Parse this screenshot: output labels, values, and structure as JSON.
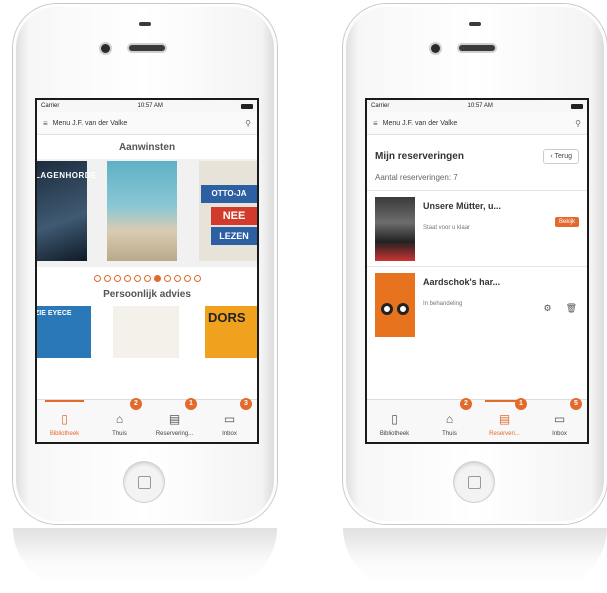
{
  "left_phone": {
    "status": {
      "carrier": "Carrier",
      "time": "10:57 AM"
    },
    "nav": {
      "title": "Menu J.F. van der Valke"
    },
    "aanwinsten_title": "Aanwinsten",
    "carousel_texts": {
      "book1": "LAGENHORDE",
      "book3_line1": "OTTO-JA",
      "book3_line2": "NEE",
      "book3_line3": "LEZEN"
    },
    "carousel": {
      "dot_count": 11,
      "active_index": 6
    },
    "advies_title": "Persoonlijk advies",
    "advies_texts": {
      "book1": "ZIE EYECE",
      "book3": "DORS"
    },
    "tabs": [
      {
        "label": "Bibliotheek",
        "badge": ""
      },
      {
        "label": "Thuis",
        "badge": "2"
      },
      {
        "label": "Reservering...",
        "badge": "1"
      },
      {
        "label": "Inbox",
        "badge": "3"
      }
    ]
  },
  "right_phone": {
    "status": {
      "carrier": "Carrier",
      "time": "10:57 AM"
    },
    "nav": {
      "title": "Menu J.F. van der Valke"
    },
    "page_title": "Mijn reserveringen",
    "back_label": "‹ Terug",
    "count_text": "Aantal reserveringen: 7",
    "items": [
      {
        "title": "Unsere Mütter, u...",
        "status": "Staat voor u klaar",
        "action": "Bekijk"
      },
      {
        "title": "Aardschok's har...",
        "status": "In behandeling"
      }
    ],
    "tabs": [
      {
        "label": "Bibliotheek",
        "badge": ""
      },
      {
        "label": "Thuis",
        "badge": "2"
      },
      {
        "label": "Reserveri...",
        "badge": "1"
      },
      {
        "label": "Inbox",
        "badge": "5"
      }
    ]
  },
  "colors": {
    "accent": "#e26a2c"
  },
  "icons": {
    "menu": "menu-icon",
    "search": "search-icon",
    "library": "library-icon",
    "home": "home-icon",
    "reservations": "reservations-icon",
    "inbox": "inbox-icon",
    "gear": "gear-icon",
    "trash": "trash-icon"
  }
}
